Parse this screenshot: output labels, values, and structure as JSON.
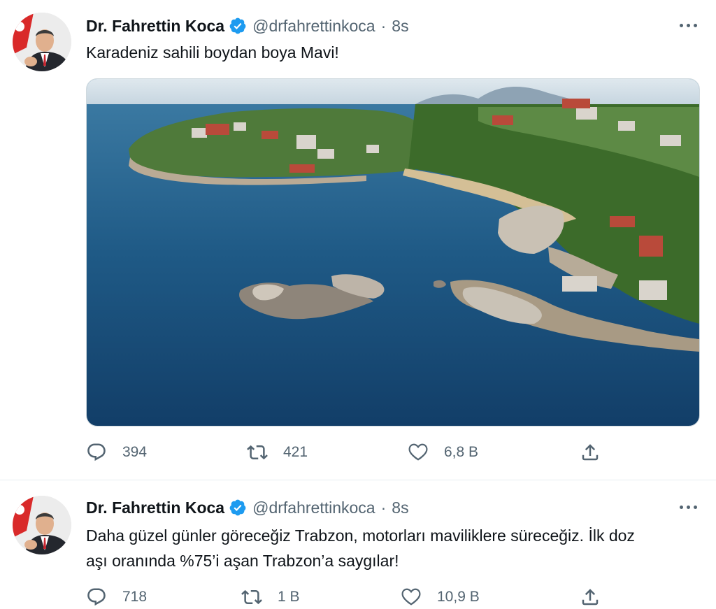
{
  "tweets": [
    {
      "name": "Dr. Fahrettin Koca",
      "handle": "@drfahrettinkoca",
      "separator": "·",
      "time": "8s",
      "text_lines": [
        "Karadeniz sahili boydan boya Mavi!"
      ],
      "media": "coastal-bay-photo",
      "actions": {
        "replies": "394",
        "retweets": "421",
        "likes": "6,8 B"
      }
    },
    {
      "name": "Dr. Fahrettin Koca",
      "handle": "@drfahrettinkoca",
      "separator": "·",
      "time": "8s",
      "text_lines": [
        "Daha güzel günler göreceğiz Trabzon, motorları maviliklere süreceğiz. İlk doz",
        "aşı oranında %75’i aşan Trabzon’a saygılar!"
      ],
      "actions": {
        "replies": "718",
        "retweets": "1 B",
        "likes": "10,9 B"
      }
    }
  ],
  "icons": {
    "verified": "verified-badge-icon",
    "more": "more-options-icon",
    "reply": "reply-icon",
    "retweet": "retweet-icon",
    "like": "like-icon",
    "share": "share-icon"
  },
  "colors": {
    "verified": "#1d9bf0",
    "secondary_text": "#536471",
    "divider": "#e6ecf0"
  }
}
